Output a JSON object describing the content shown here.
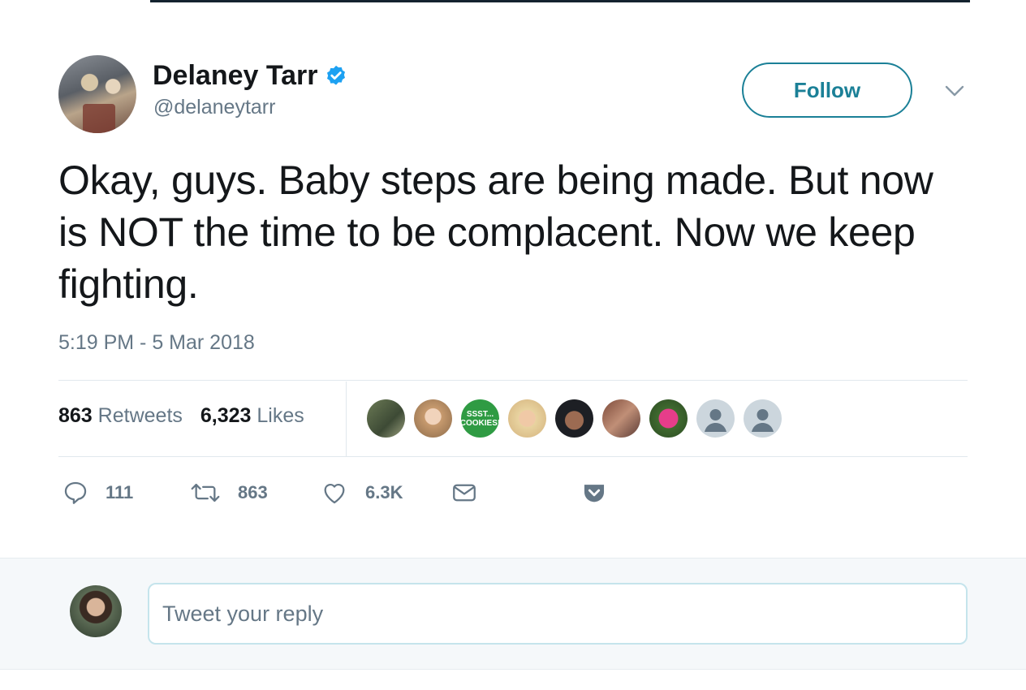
{
  "author": {
    "name": "Delaney Tarr",
    "handle": "@delaneytarr",
    "verified": true,
    "avatar_icon": "profile-photo"
  },
  "header": {
    "follow_label": "Follow",
    "menu_icon": "chevron-down-icon"
  },
  "tweet": {
    "text": "Okay, guys. Baby steps are being made. But now is NOT the time to be complacent. Now we keep fighting.",
    "timestamp": "5:19 PM - 5 Mar 2018"
  },
  "stats": {
    "retweets_count": "863",
    "retweets_label": "Retweets",
    "likes_count": "6,323",
    "likes_label": "Likes"
  },
  "likers": [
    {
      "icon": "liker-avatar-1"
    },
    {
      "icon": "liker-avatar-2"
    },
    {
      "icon": "liker-avatar-3",
      "text": [
        "SSST...",
        "COOKIES!"
      ]
    },
    {
      "icon": "liker-avatar-4"
    },
    {
      "icon": "liker-avatar-5"
    },
    {
      "icon": "liker-avatar-6"
    },
    {
      "icon": "liker-avatar-7"
    },
    {
      "icon": "default-avatar"
    },
    {
      "icon": "default-avatar"
    }
  ],
  "actions": {
    "reply_count": "111",
    "retweet_count": "863",
    "like_count": "6.3K",
    "icons": [
      "reply-icon",
      "retweet-icon",
      "heart-icon",
      "envelope-icon",
      "pocket-icon"
    ]
  },
  "reply_box": {
    "placeholder": "Tweet your reply"
  },
  "colors": {
    "follow_border": "#1b8097",
    "muted_text": "#657786",
    "verified_blue": "#1da1f2"
  }
}
